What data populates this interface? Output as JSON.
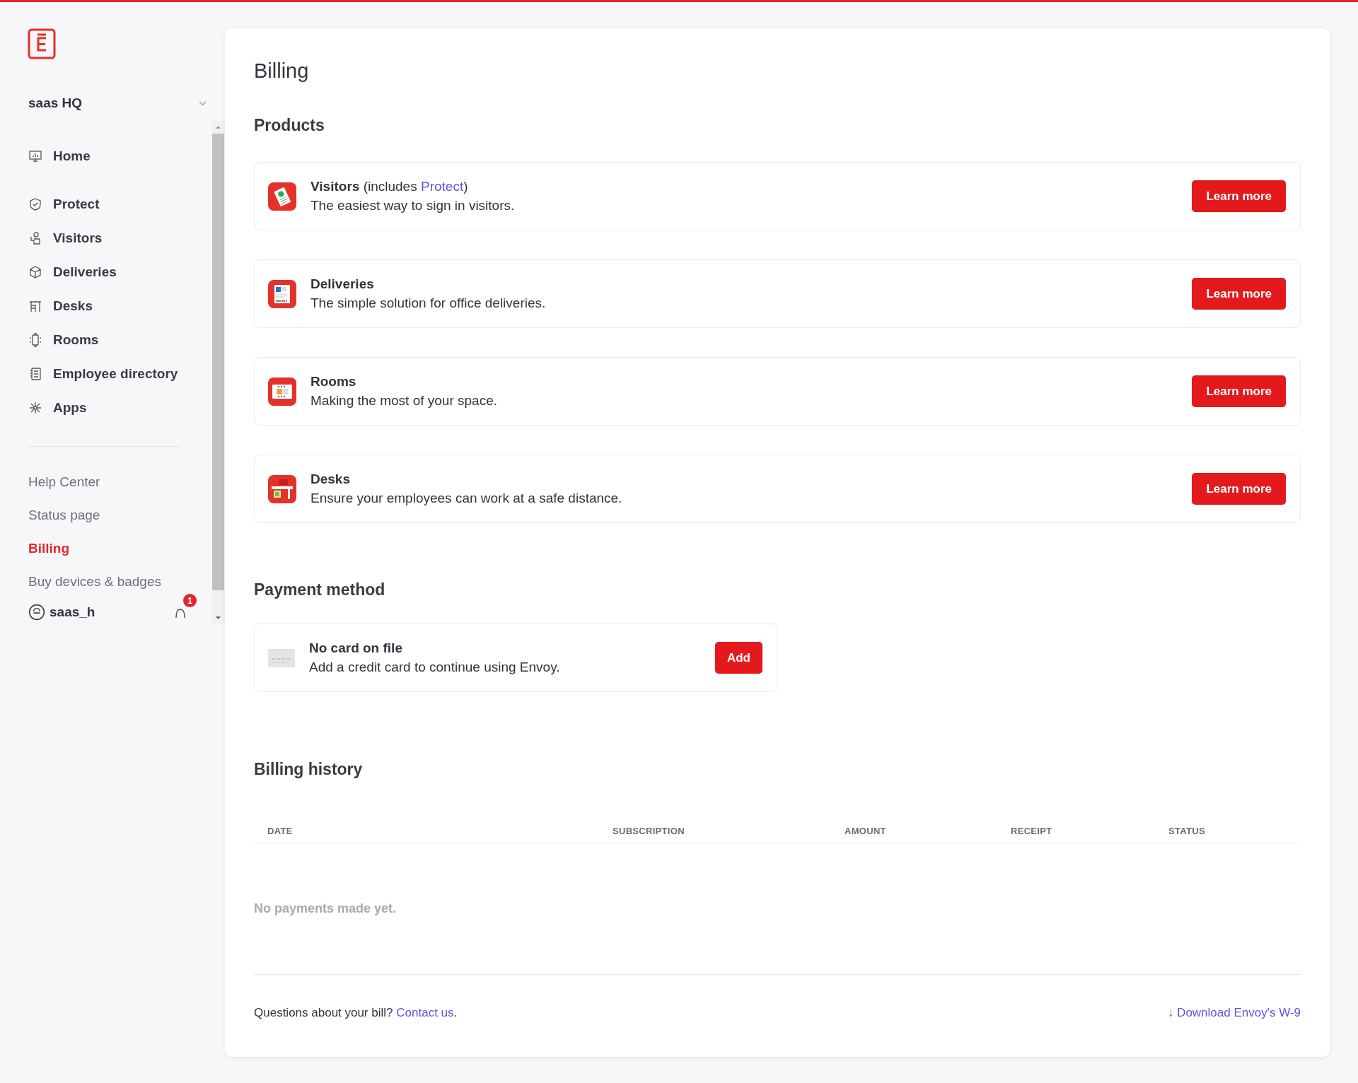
{
  "sidebar": {
    "workspace": "saas HQ",
    "nav": [
      {
        "kind": "home",
        "label": "Home",
        "selected": false
      },
      {
        "kind": "protect",
        "label": "Protect",
        "selected": false
      },
      {
        "kind": "visitors",
        "label": "Visitors",
        "selected": false
      },
      {
        "kind": "deliveries",
        "label": "Deliveries",
        "selected": false
      },
      {
        "kind": "desks",
        "label": "Desks",
        "selected": false
      },
      {
        "kind": "rooms",
        "label": "Rooms",
        "selected": false
      },
      {
        "kind": "directory",
        "label": "Employee directory",
        "selected": false
      },
      {
        "kind": "apps",
        "label": "Apps",
        "selected": false
      }
    ],
    "links": [
      {
        "label": "Help Center",
        "selected": false
      },
      {
        "label": "Status page",
        "selected": false
      },
      {
        "label": "Billing",
        "selected": true
      },
      {
        "label": "Buy devices & badges",
        "selected": false
      }
    ],
    "user": {
      "name": "saas_h",
      "notifications": "1"
    }
  },
  "page": {
    "title": "Billing",
    "products": {
      "heading": "Products",
      "items": [
        {
          "kind": "visitors",
          "name": "Visitors",
          "note": {
            "before": " (includes ",
            "link": "Protect",
            "after": ")"
          },
          "description": "The easiest way to sign in visitors.",
          "button": "Learn more"
        },
        {
          "kind": "deliveries",
          "name": "Deliveries",
          "description": "The simple solution for office deliveries.",
          "button": "Learn more"
        },
        {
          "kind": "rooms",
          "name": "Rooms",
          "description": "Making the most of your space.",
          "button": "Learn more"
        },
        {
          "kind": "desks",
          "name": "Desks",
          "description": "Ensure your employees can work at a safe distance.",
          "button": "Learn more"
        }
      ]
    },
    "payment": {
      "heading": "Payment method",
      "title": "No card on file",
      "description": "Add a credit card to continue using Envoy.",
      "button": "Add"
    },
    "history": {
      "heading": "Billing history",
      "columns": [
        "DATE",
        "SUBSCRIPTION",
        "AMOUNT",
        "RECEIPT",
        "STATUS"
      ],
      "empty": "No payments made yet."
    },
    "footer": {
      "question": "Questions about your bill? ",
      "contact": "Contact us",
      "after": ".",
      "download": "↓ Download Envoy's W-9"
    }
  }
}
